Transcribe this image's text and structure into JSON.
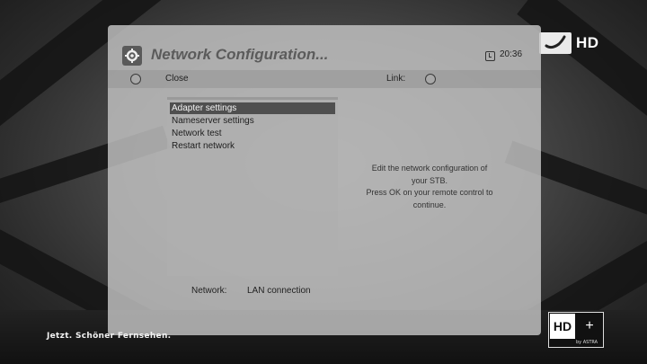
{
  "dialog": {
    "title": "Network Configuration...",
    "time": "20:36",
    "close_label": "Close",
    "link_label": "Link:",
    "menu": [
      {
        "label": "Adapter settings",
        "selected": true
      },
      {
        "label": "Nameserver settings",
        "selected": false
      },
      {
        "label": "Network test",
        "selected": false
      },
      {
        "label": "Restart network",
        "selected": false
      }
    ],
    "description": [
      "Edit the network configuration of",
      "your STB.",
      "Press OK on your remote control to",
      "continue."
    ],
    "network_label": "Network:",
    "network_value": "LAN connection"
  },
  "broadcast": {
    "channel_badge": "HD",
    "slogan": "Jetzt. Schöner Fernsehen.",
    "hdplus_left": "HD",
    "hdplus_right": "+",
    "hdplus_sub": "by ASTRA"
  },
  "icons": {
    "title": "settings-gear-icon",
    "clock": "clock-icon",
    "close_button": "round-button-icon",
    "link_status": "round-status-icon",
    "channel_logo": "channel-logo-icon"
  }
}
